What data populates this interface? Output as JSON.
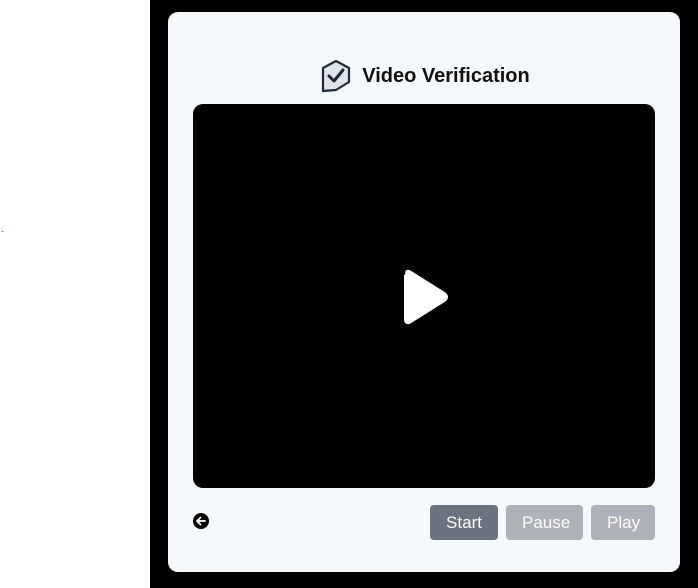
{
  "header": {
    "title": "Video Verification",
    "logo_icon": "shield-check-icon"
  },
  "video": {
    "state": "idle",
    "overlay_icon": "play-icon"
  },
  "footer": {
    "back_icon": "arrow-left-circle-icon",
    "buttons": {
      "start_label": "Start",
      "pause_label": "Pause",
      "play_label": "Play"
    }
  },
  "colors": {
    "backdrop": "#000000",
    "card": "#f6f9fb",
    "start_button": "#6b7280",
    "disabled_button": "#aeb1b8",
    "video_area": "#000000"
  }
}
